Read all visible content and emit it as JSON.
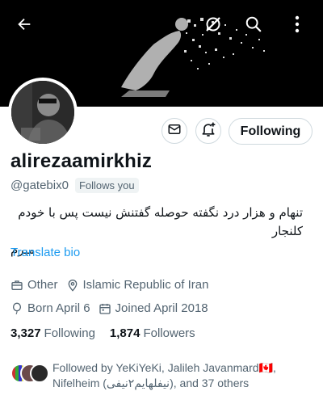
{
  "profile": {
    "display_name": "alirezaamirkhiz",
    "handle": "@gatebix0",
    "follows_you_label": "Follows you",
    "bio_line1": "تنهام و هزار درد نگفته  حوصله گفتنش نیست  پس با خودم کلنجار",
    "bio_line2": "میرم",
    "translate_label": "Translate bio"
  },
  "meta": {
    "category": "Other",
    "location": "Islamic Republic of Iran",
    "born": "Born April 6",
    "joined": "Joined April 2018"
  },
  "stats": {
    "following_count": "3,327",
    "following_label": "Following",
    "followers_count": "1,874",
    "followers_label": "Followers"
  },
  "actions": {
    "follow_label": "Following"
  },
  "followed_by": {
    "line1": "Followed by YeKiYeKi, Jalileh Javanmard🇨🇦,",
    "line2": "Nifelheim (نیفلهایم۲نیفی), and 37 others"
  },
  "icons": {
    "back": "arrow-left-icon",
    "grok": "grok-icon",
    "search": "search-icon",
    "more": "more-vertical-icon",
    "message": "envelope-icon",
    "notify": "bell-plus-icon",
    "category": "briefcase-icon",
    "location": "location-pin-icon",
    "born": "balloon-icon",
    "joined": "calendar-icon"
  },
  "colors": {
    "accent": "#1d9bf0",
    "secondary_text": "#536471",
    "primary_text": "#0f1419",
    "border": "#cfd9de"
  }
}
